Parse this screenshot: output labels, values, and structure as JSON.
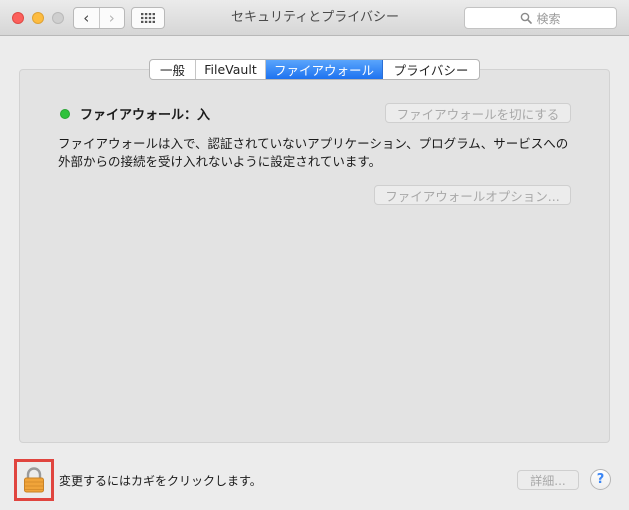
{
  "window": {
    "title": "セキュリティとプライバシー",
    "search_placeholder": "検索"
  },
  "toolbar": {
    "back_symbol": "‹",
    "forward_symbol": "›"
  },
  "tabs": [
    {
      "label": "一般",
      "selected": false
    },
    {
      "label": "FileVault",
      "selected": false
    },
    {
      "label": "ファイアウォール",
      "selected": true
    },
    {
      "label": "プライバシー",
      "selected": false
    }
  ],
  "firewall": {
    "status_text": "ファイアウォール：入",
    "status_color": "#2fc23c",
    "turn_off_label": "ファイアウォールを切にする",
    "description_line1": "ファイアウォールは入で、認証されていないアプリケーション、プログラム、サービスへの",
    "description_line2": "外部からの接続を受け入れないように設定されています。",
    "options_label": "ファイアウォールオプション..."
  },
  "footer": {
    "lock_text": "変更するにはカギをクリックします。",
    "advanced_label": "詳細...",
    "help_label": "?"
  },
  "colors": {
    "accent": "#1d72f0",
    "highlight_border": "#e0453f"
  }
}
